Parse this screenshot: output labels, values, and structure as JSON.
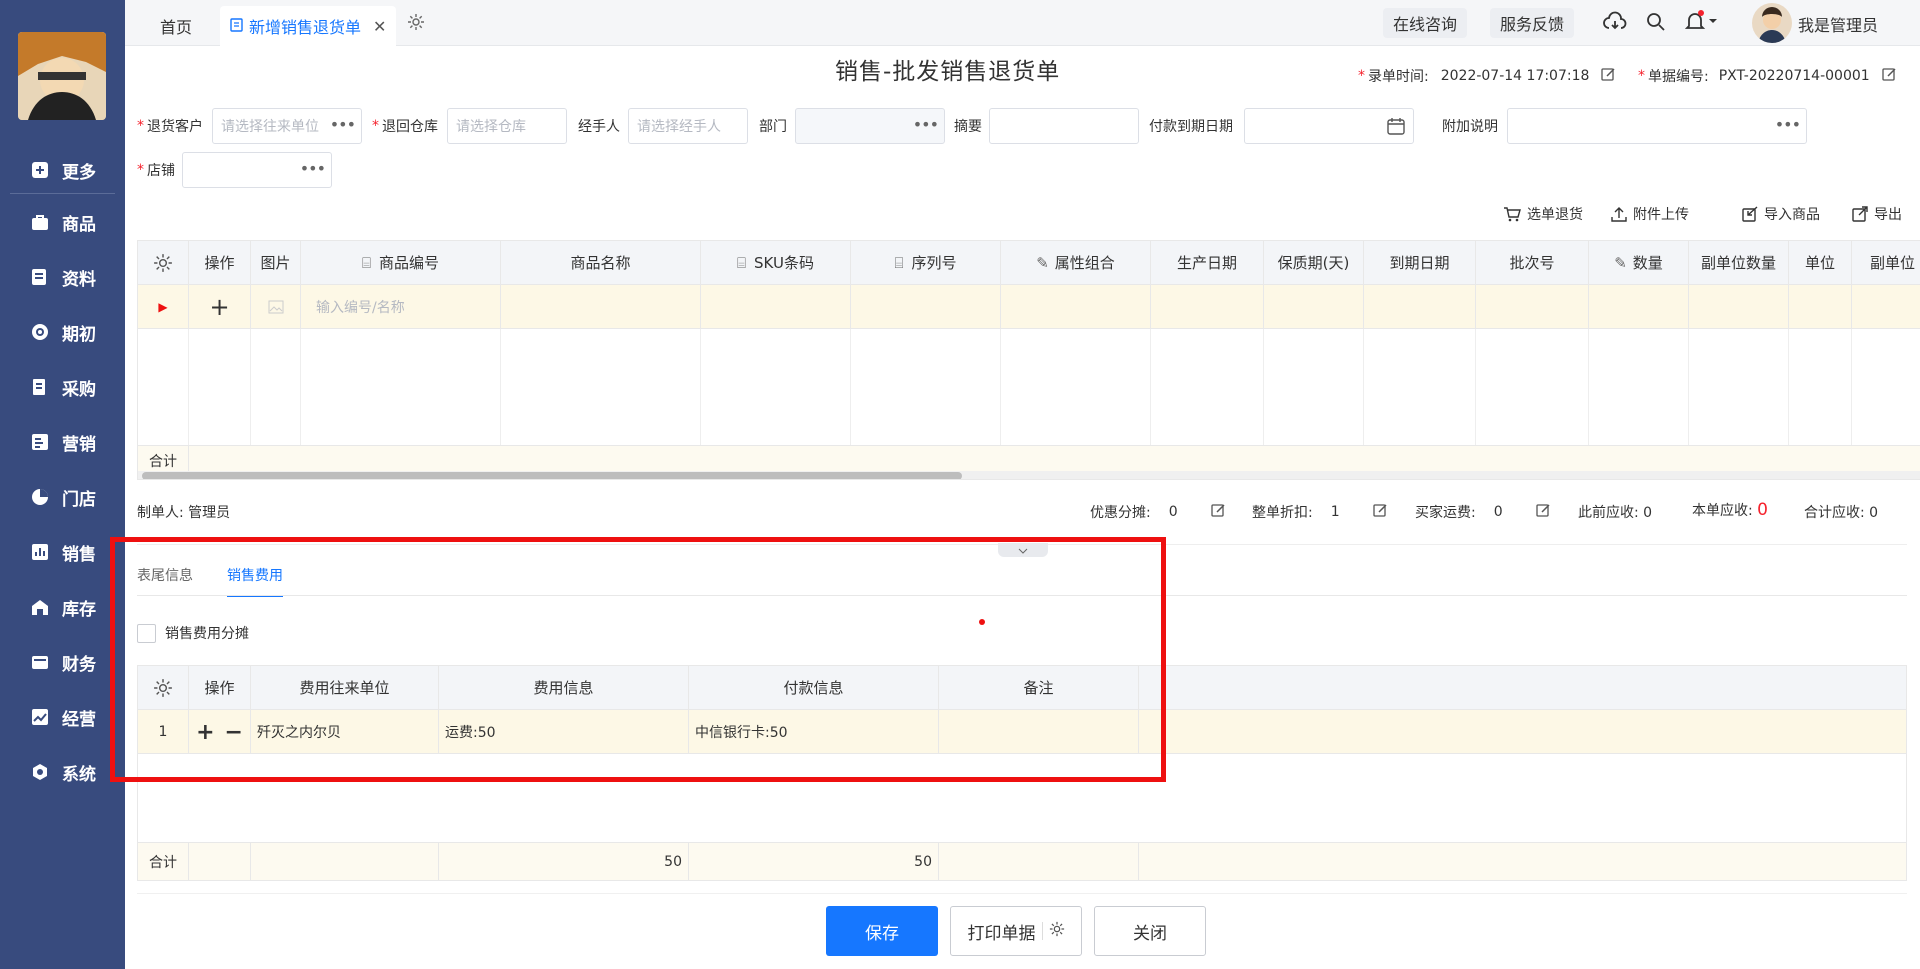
{
  "sidebar": {
    "items": [
      {
        "label": "更多"
      },
      {
        "label": "商品"
      },
      {
        "label": "资料"
      },
      {
        "label": "期初"
      },
      {
        "label": "采购"
      },
      {
        "label": "营销"
      },
      {
        "label": "门店"
      },
      {
        "label": "销售"
      },
      {
        "label": "库存"
      },
      {
        "label": "财务"
      },
      {
        "label": "经营"
      },
      {
        "label": "系统"
      }
    ]
  },
  "tabs": {
    "home": "首页",
    "active": "新增销售退货单"
  },
  "header": {
    "consult": "在线咨询",
    "feedback": "服务反馈",
    "user": "我是管理员"
  },
  "form": {
    "title": "销售-批发销售退货单",
    "entry_time_label": "录单时间:",
    "entry_time": "2022-07-14 17:07:18",
    "doc_no_label": "单据编号:",
    "doc_no": "PXT-20220714-00001",
    "customer_label": "退货客户",
    "customer_ph": "请选择往来单位",
    "warehouse_label": "退回仓库",
    "warehouse_ph": "请选择仓库",
    "handler_label": "经手人",
    "handler_ph": "请选择经手人",
    "dept_label": "部门",
    "summary_label": "摘要",
    "due_label": "付款到期日期",
    "note_label": "附加说明",
    "store_label": "店铺"
  },
  "toolbar": {
    "select_return": "选单退货",
    "upload": "附件上传",
    "import": "导入商品",
    "export": "导出"
  },
  "goods_table": {
    "headers": [
      "操作",
      "图片",
      "商品编号",
      "商品名称",
      "SKU条码",
      "序列号",
      "属性组合",
      "生产日期",
      "保质期(天)",
      "到期日期",
      "批次号",
      "数量",
      "副单位数量",
      "单位",
      "副单位"
    ],
    "input_ph": "输入编号/名称",
    "total_label": "合计"
  },
  "footer_info": {
    "maker_label": "制单人:",
    "maker": "管理员",
    "discount_share_label": "优惠分摊:",
    "discount_share": "0",
    "whole_discount_label": "整单折扣:",
    "whole_discount": "1",
    "freight_label": "买家运费:",
    "freight": "0",
    "prev_recv_label": "此前应收:",
    "prev_recv": "0",
    "this_recv_label": "本单应收:",
    "this_recv": "0",
    "total_recv_label": "合计应收:",
    "total_recv": "0"
  },
  "lower_tabs": {
    "tail_info": "表尾信息",
    "sales_cost": "销售费用"
  },
  "cost_section": {
    "checkbox_label": "销售费用分摊",
    "headers": [
      "操作",
      "费用往来单位",
      "费用信息",
      "付款信息",
      "备注"
    ],
    "rows": [
      {
        "no": "1",
        "unit": "歼灭之内尔贝",
        "cost": "运费:50",
        "pay": "中信银行卡:50",
        "remark": ""
      }
    ],
    "total_label": "合计",
    "total_cost": "50",
    "total_pay": "50"
  },
  "actions": {
    "save": "保存",
    "print": "打印单据",
    "close": "关闭"
  },
  "colors": {
    "accent": "#1677ff",
    "sidebar": "#384b7e",
    "highlight": "#ee1010"
  }
}
